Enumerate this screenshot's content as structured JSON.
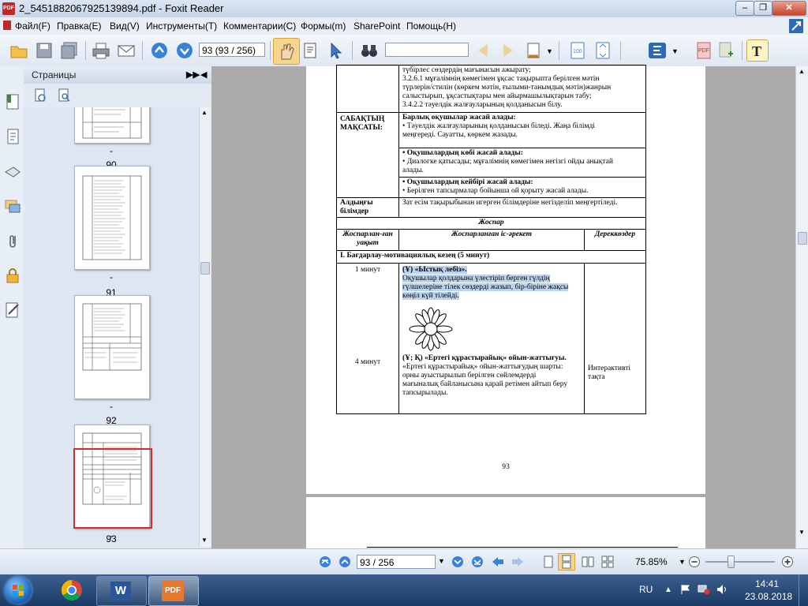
{
  "window": {
    "title": "2_5451882067925139894.pdf - Foxit Reader",
    "app_icon_text": "PDF"
  },
  "menu": [
    "Файл(F)",
    "Правка(E)",
    "Вид(V)",
    "Инструменты(T)",
    "Комментарии(C)",
    "Формы(m)",
    "SharePoint",
    "Помощь(H)"
  ],
  "toolbar": {
    "page_field": "93 (93 / 256)",
    "search_value": ""
  },
  "pages_panel": {
    "title": "Страницы",
    "thumbnails": [
      {
        "label": "90"
      },
      {
        "label": "91"
      },
      {
        "label": "92"
      },
      {
        "label": "93",
        "selected": true
      }
    ],
    "thumb_mark": "-"
  },
  "document": {
    "top_lines": [
      "түбірлес сөздердің мағынасын ажырату;",
      "3.2.6.1 мұғалімнің көмегімен ұқсас тақырыпта берілген мәтін",
      "түрлерін/стилін (көркем мәтін, ғылыми-танымдық мәтін)жанрын",
      "салыстырып, ұқсастықтары мен айырмашылықтарын табу;",
      "3.4.2.2 тәуелдік жалғауларының қолданысын білу."
    ],
    "goals_label": "САБАҚТЫҢ МАҚСАТЫ:",
    "goals": [
      {
        "title": "Барлық оқушылар жасай алады:",
        "lines": [
          "•   Тәуелдік жалғауларының қолданысын  біледі. Жаңа білімді",
          "меңгереді. Сауатты, көркем жазады."
        ]
      },
      {
        "title": "•  Оқушылардың көбі жасай алады:",
        "lines": [
          "• Диалогке қатысады; мұғалімнің көмегімен негізгі ойды анықтай",
          "алады."
        ]
      },
      {
        "title": "•  Оқушылардың кейбірі жасай алады:",
        "lines": [
          "• Берілген тапсырмалар бойынша ой қорыту жасай алады."
        ]
      }
    ],
    "prior_label": "Алдыңғы білімдер",
    "prior_text": "Зат есім тақырыбынан  игерген білімдеріне  негізделіп меңгертіледі.",
    "plan_title": "Жоспар",
    "plan_headers": [
      "Жоспарлан-ған уақыт",
      "Жоспарланған іс-әрекет",
      "Дереккөздер"
    ],
    "stage_title": "I. Бағдарлау-мотивациялық кезең (5 минут)",
    "row1_time": "1 минут",
    "row1_title": "(Ұ) «Ыстық лебіз».",
    "row1_lines": [
      "Оқушылар қолдарына үлестіріп берген гүлдің",
      "гүлшелеріне тілек сөздерді жазып, бір-біріне жақсы",
      "көңіл күй тілейді."
    ],
    "row2_time": "4 минут",
    "row2_title": "(Ұ; Қ) «Ертегі құрастырайық» ойын-жаттығуы.",
    "row2_lines": [
      "«Ертегі құрастырайық» ойын-жаттығудың шарты:",
      "орны ауыстырылып берілген сөйлемдерді",
      "мағыналық байланысына қарай ретімен айтып беру",
      "тапсырылады."
    ],
    "row2_source": [
      "Интерактивті",
      "тақта"
    ],
    "page_number": "93"
  },
  "statusbar": {
    "page_field": "93 / 256",
    "zoom": "75.85%"
  },
  "taskbar": {
    "lang": "RU",
    "time": "14:41",
    "date": "23.08.2018",
    "pdf_label": "PDF",
    "word_label": "W"
  }
}
